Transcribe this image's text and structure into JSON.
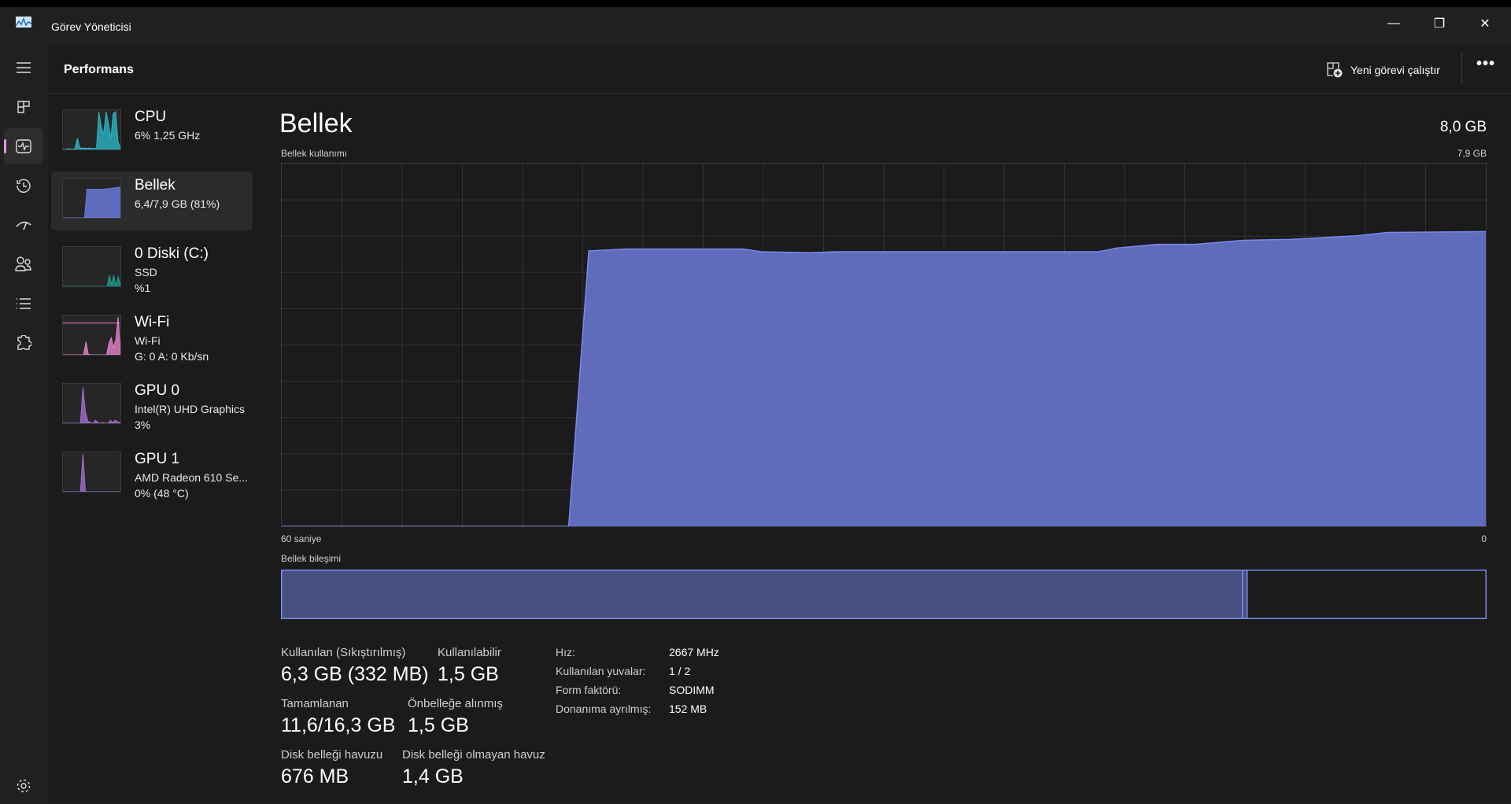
{
  "window": {
    "title": "Görev Yöneticisi",
    "minimize": "—",
    "restore": "❐",
    "close": "✕"
  },
  "header": {
    "title": "Performans",
    "run_task": "Yeni görevi çalıştır",
    "more": "•••"
  },
  "sidebar": [
    {
      "name": "CPU",
      "sub1": "6%  1,25 GHz",
      "color": "#2bb5c6",
      "spark": [
        0,
        0,
        2,
        1,
        1,
        2,
        30,
        5,
        3,
        4,
        3,
        4,
        3,
        3,
        4,
        100,
        60,
        40,
        100,
        70,
        30,
        95,
        100,
        20,
        5
      ]
    },
    {
      "name": "Bellek",
      "sub1": "6,4/7,9 GB (81%)",
      "color": "#6a78d8",
      "spark": [
        0,
        0,
        0,
        0,
        0,
        0,
        0,
        0,
        0,
        0,
        76,
        76,
        76,
        76,
        76,
        76,
        76,
        76,
        77,
        77,
        78,
        79,
        80,
        81,
        81
      ]
    },
    {
      "name": "0 Diski (C:)",
      "sub1": "SSD",
      "sub2": "%1",
      "color": "#1b9a8a",
      "spark": [
        0,
        0,
        0,
        0,
        0,
        0,
        0,
        0,
        0,
        0,
        0,
        0,
        0,
        0,
        0,
        0,
        0,
        0,
        0,
        0,
        0,
        30,
        5,
        30,
        2,
        25,
        5
      ]
    },
    {
      "name": "Wi-Fi",
      "sub1": "Wi-Fi",
      "sub2": "G: 0 A: 0 Kb/sn",
      "color": "#e383c9",
      "spark": [
        0,
        0,
        0,
        0,
        0,
        0,
        0,
        0,
        0,
        0,
        35,
        2,
        0,
        0,
        0,
        0,
        0,
        0,
        0,
        0,
        30,
        45,
        20,
        40,
        100,
        10
      ]
    },
    {
      "name": "GPU 0",
      "sub1": "Intel(R) UHD Graphics",
      "sub2": "3%",
      "color": "#9c6fd0",
      "spark": [
        0,
        0,
        0,
        0,
        0,
        0,
        0,
        0,
        95,
        30,
        5,
        2,
        0,
        8,
        2,
        0,
        2,
        0,
        0,
        8,
        2,
        8,
        3,
        2
      ]
    },
    {
      "name": "GPU 1",
      "sub1": "AMD Radeon 610 Se...",
      "sub2": "0%  (48 °C)",
      "color": "#9c6fd0",
      "spark": [
        0,
        0,
        0,
        0,
        0,
        0,
        0,
        0,
        100,
        0,
        0,
        0,
        0,
        0,
        0,
        0,
        0,
        0,
        0,
        0,
        0,
        0,
        0,
        0
      ]
    }
  ],
  "detail": {
    "title": "Bellek",
    "total": "8,0 GB",
    "usage_label": "Bellek kullanımı",
    "max_label": "7,9 GB",
    "time_left": "60 saniye",
    "time_right": "0",
    "composition_label": "Bellek bileşimi"
  },
  "chart_data": {
    "type": "area",
    "title": "Bellek kullanımı",
    "xlabel": "seconds ago",
    "ylabel": "GB",
    "xlim": [
      60,
      0
    ],
    "ylim": [
      0,
      7.9
    ],
    "grid": {
      "columns": 20,
      "rows": 10
    },
    "x": [
      60,
      45.7,
      44.7,
      42.8,
      37.0,
      36.1,
      33.7,
      32.3,
      19.3,
      18.4,
      16.4,
      14.5,
      12.1,
      9.7,
      6.4,
      4.9,
      0
    ],
    "values": [
      0,
      0,
      6.0,
      6.04,
      6.04,
      5.98,
      5.96,
      5.98,
      5.98,
      6.06,
      6.14,
      6.14,
      6.23,
      6.25,
      6.33,
      6.4,
      6.42
    ],
    "color": "#6470c4",
    "line_color": "#7d89ea"
  },
  "composition": {
    "in_use_gb": 6.3,
    "modified_gb": 0.03,
    "standby_gb": 1.5,
    "free_gb": 0.0,
    "total_gb": 7.9,
    "in_use_color": "#464f80",
    "border_color": "#7d89ea"
  },
  "stats": {
    "in_use_label": "Kullanılan (Sıkıştırılmış)",
    "in_use": "6,3 GB (332 MB)",
    "available_label": "Kullanılabilir",
    "available": "1,5 GB",
    "committed_label": "Tamamlanan",
    "committed": "11,6/16,3 GB",
    "cached_label": "Önbelleğe alınmış",
    "cached": "1,5 GB",
    "paged_label": "Disk belleği havuzu",
    "paged": "676 MB",
    "nonpaged_label": "Disk belleği olmayan havuz",
    "nonpaged": "1,4 GB"
  },
  "properties": [
    {
      "label": "Hız:",
      "value": "2667 MHz"
    },
    {
      "label": "Kullanılan yuvalar:",
      "value": "1 / 2"
    },
    {
      "label": "Form faktörü:",
      "value": "SODIMM"
    },
    {
      "label": "Donanıma ayrılmış:",
      "value": "152 MB"
    }
  ]
}
